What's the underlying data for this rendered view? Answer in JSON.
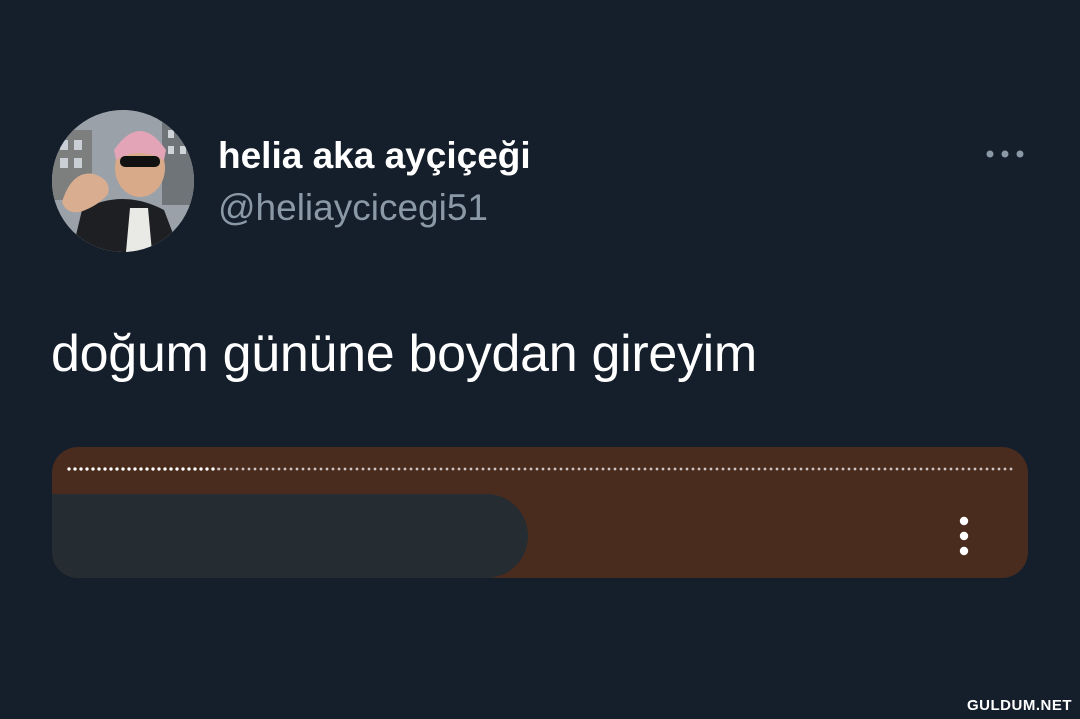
{
  "tweet": {
    "author": {
      "display_name": "helia aka ayçiçeği",
      "handle": "@heliaycicegi51",
      "avatar_icon": "user-avatar-photo"
    },
    "text": "doğum gününe boydan gireyim",
    "menu_icon": "more-horizontal-icon"
  },
  "media_player": {
    "progress": 0.16,
    "menu_icon": "more-vertical-icon",
    "colors": {
      "card_background": "#4a2c1f",
      "control_pill": "#252c32"
    }
  },
  "watermark": {
    "text": "GULDUM.NET"
  },
  "colors": {
    "background": "#151e2b",
    "primary_text": "#ffffff",
    "secondary_text": "#8b98a5"
  }
}
